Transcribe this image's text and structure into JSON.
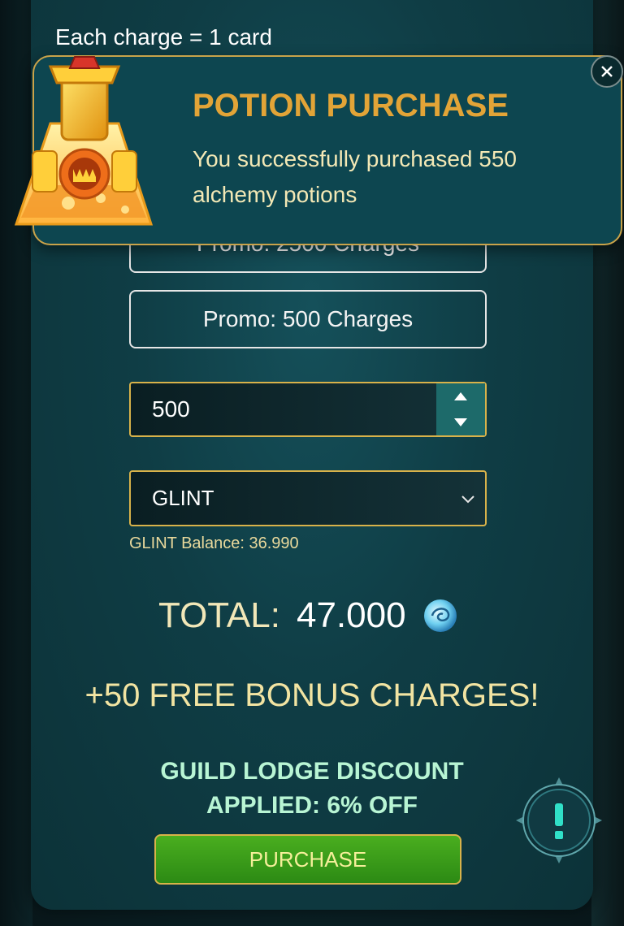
{
  "header": {
    "charge_note": "Each charge = 1 card"
  },
  "promos": [
    {
      "label": "Promo: 2500 Charges"
    },
    {
      "label": "Promo: 500 Charges"
    }
  ],
  "quantity": {
    "value": "500"
  },
  "currency": {
    "selected": "GLINT",
    "balance_text": "GLINT Balance: 36.990"
  },
  "total": {
    "label": "TOTAL:",
    "value": "47.000"
  },
  "bonus": {
    "text": "+50 FREE BONUS CHARGES!"
  },
  "discount": {
    "line1": "GUILD LODGE DISCOUNT",
    "line2": "APPLIED: 6% OFF"
  },
  "actions": {
    "purchase_label": "PURCHASE"
  },
  "toast": {
    "title": "POTION PURCHASE",
    "message": "You successfully purchased 550 alchemy potions",
    "icon": "alchemy-potion-icon"
  },
  "colors": {
    "accent_gold": "#d8b24a",
    "title_orange": "#e2a437",
    "purchase_green": "#3f9f1a",
    "panel_teal": "#0f3d45"
  }
}
